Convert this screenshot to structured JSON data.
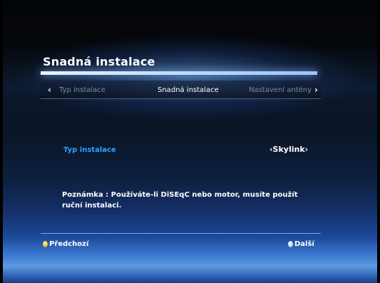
{
  "header": {
    "title": "Snadná instalace"
  },
  "wizard_tabs": {
    "prev_label": "Typ instalace",
    "current_label": "Snadná instalace",
    "next_label": "Nastavení antény",
    "left_arrow": "‹",
    "right_arrow": "›"
  },
  "settings": {
    "install_type_label": "Typ instalace",
    "install_type_value": "‹Skylink›"
  },
  "note": {
    "text": "Poznámka : Používáte-li DiSEqC nebo motor, musíte použít ruční instalaci."
  },
  "footer": {
    "prev_label": "Předchozí",
    "next_label": "Další",
    "prev_key_color": "#e8c020",
    "next_key_color": "#b8d8ff"
  },
  "icons": {
    "prev_key": "yellow-button-icon",
    "next_key": "blue-button-icon"
  }
}
